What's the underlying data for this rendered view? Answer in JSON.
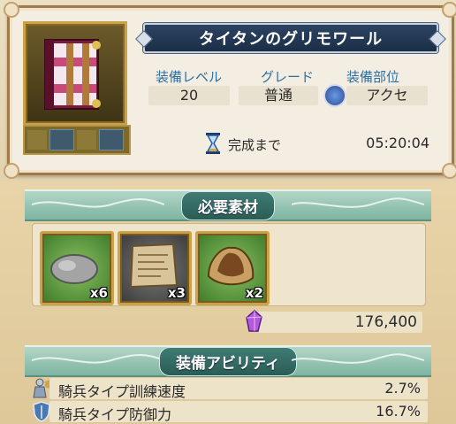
{
  "item": {
    "name": "タイタンのグリモワール",
    "level_label": "装備レベル",
    "level_value": "20",
    "grade_label": "グレード",
    "grade_value": "普通",
    "slot_label": "装備部位",
    "slot_value": "アクセ",
    "timer_label": "完成まで",
    "timer_value": "05:20:04",
    "icon": "grimoire-book-icon"
  },
  "materials": {
    "header": "必要素材",
    "items": [
      {
        "icon": "stone-icon",
        "count": "x6"
      },
      {
        "icon": "scroll-map-icon",
        "count": "x3"
      },
      {
        "icon": "leather-hide-icon",
        "count": "x2"
      }
    ],
    "cost_icon": "purple-crystal-icon",
    "cost_value": "176,400"
  },
  "abilities": {
    "header": "装備アビリティ",
    "items": [
      {
        "icon": "cavalry-knight-icon",
        "name": "騎兵タイプ訓練速度",
        "value": "2.7%"
      },
      {
        "icon": "shield-icon",
        "name": "騎兵タイプ防御力",
        "value": "16.7%"
      }
    ]
  },
  "colors": {
    "title_banner": "#1b2e46",
    "label_blue": "#2d6fa0",
    "section_teal": "#7db4a2",
    "frame_gold": "#c9a24a"
  }
}
